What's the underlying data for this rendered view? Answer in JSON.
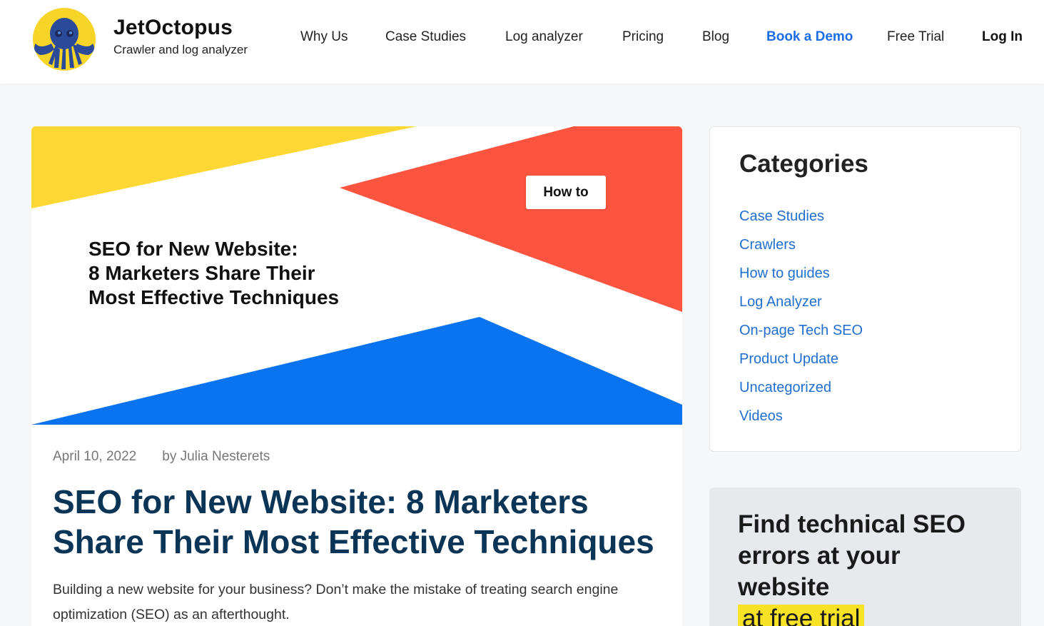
{
  "brand": {
    "title": "JetOctopus",
    "subtitle": "Crawler and log analyzer"
  },
  "nav": {
    "items": [
      {
        "label": "Why Us"
      },
      {
        "label": "Case Studies"
      },
      {
        "label": "Log analyzer"
      },
      {
        "label": "Pricing"
      },
      {
        "label": "Blog"
      },
      {
        "label": "Book a Demo"
      },
      {
        "label": "Free Trial"
      },
      {
        "label": "Log In"
      }
    ]
  },
  "hero": {
    "badge": "How to",
    "title_lines": [
      "SEO for New Website:",
      "8 Marketers Share Their",
      "Most Effective Techniques"
    ]
  },
  "post": {
    "date": "April 10, 2022",
    "author": "by Julia Nesterets",
    "title_lines": [
      "SEO for New Website: 8 Marketers",
      "Share Their Most Effective Techniques"
    ],
    "excerpt": "Building a new website for your business? Don’t make the mistake of treating search engine optimization (SEO) as an afterthought."
  },
  "sidebar": {
    "categories_title": "Categories",
    "categories": [
      "Case Studies",
      "Crawlers",
      "How to guides",
      "Log Analyzer",
      "On-page Tech SEO",
      "Product Update",
      "Uncategorized",
      "Videos"
    ],
    "promo": {
      "line1": "Find technical SEO",
      "line2": "errors at your",
      "line3": "website",
      "highlight": "at free trial"
    }
  },
  "colors": {
    "accent_blue": "#1c6ee8",
    "link_blue": "#1f6fd1",
    "title_navy": "#0b3556",
    "hero_yellow": "#fdd835",
    "hero_red": "#fd5440",
    "hero_blue": "#0a73f0",
    "promo_highlight": "#f8e226"
  },
  "icons": {
    "logo": "octopus-logo-icon"
  }
}
